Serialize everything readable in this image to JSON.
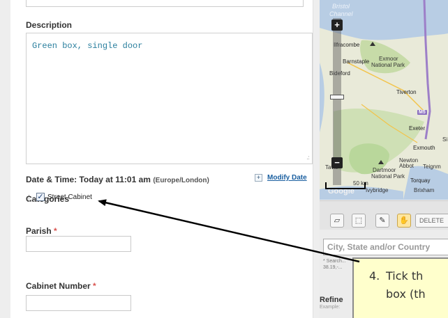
{
  "form": {
    "description_label": "Description",
    "description_value": "Green box, single door",
    "resize_grip": ".:",
    "datetime_label": "Date & Time: Today at 11:01 am",
    "datetime_tz": "(Europe/London)",
    "modify_date_label": "Modify Date",
    "categories_label": "Categories",
    "category_item": "Street Cabinet",
    "category_checked": true,
    "parish_label": "Parish",
    "cabinet_number_label": "Cabinet Number",
    "required_mark": "*"
  },
  "map": {
    "places": {
      "bristol": "Bristol",
      "channel": "Channel",
      "ilfracombe": "Ilfracombe",
      "barnstaple": "Barnstaple",
      "exmoor": "Exmoor",
      "national_park": "National Park",
      "bideford": "Bideford",
      "tiverton": "Tiverton",
      "exeter": "Exeter",
      "exmouth": "Exmouth",
      "newton": "Newton",
      "abbot_teign": "Abbot",
      "teignmouth": "Teignm",
      "dartmoor": "Dartmoor",
      "dartmoor_np": "National Park",
      "torquay": "Torquay",
      "brixham": "Brixham",
      "tavistock": "Tavis",
      "ivybridge": "Ivybridge",
      "google": "Google",
      "scale": "50 km",
      "si": "Si"
    },
    "road_m5": "M5",
    "zoom_in": "+",
    "zoom_out": "−",
    "toolbar_delete": "DELETE",
    "location_placeholder": "City, State and/or Country",
    "location_hint_1": "* Search...",
    "location_hint_2": "38.19,-...",
    "refine_label": "Refine",
    "refine_example": "Example:"
  },
  "callout": {
    "number": "4.",
    "line1": "Tick th",
    "line2": "box (th"
  },
  "colors": {
    "map_water": "#b8cde4",
    "map_land": "#e9ead9",
    "map_park": "#b9d79b",
    "callout_bg": "#ffffcc",
    "link": "#1a5fa0",
    "required": "#d9534f"
  }
}
